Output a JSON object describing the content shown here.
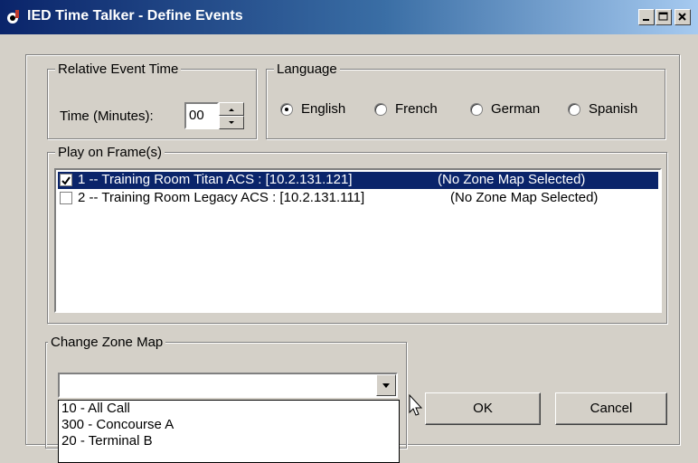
{
  "window": {
    "title": "IED Time Talker - Define Events",
    "icon": "app-icon",
    "controls": [
      "minimize-icon",
      "maximize-icon",
      "close-icon"
    ]
  },
  "relative_event_time": {
    "legend": "Relative Event Time",
    "label": "Time (Minutes):",
    "value": "00"
  },
  "language": {
    "legend": "Language",
    "options": [
      {
        "label": "English",
        "selected": true
      },
      {
        "label": "French",
        "selected": false
      },
      {
        "label": "German",
        "selected": false
      },
      {
        "label": "Spanish",
        "selected": false
      }
    ]
  },
  "play_on_frames": {
    "legend": "Play on Frame(s)",
    "items": [
      {
        "label": "1 -- Training Room Titan ACS : [10.2.131.121]",
        "zone": "(No Zone Map Selected)",
        "checked": true,
        "selected": true
      },
      {
        "label": "2 -- Training Room Legacy ACS : [10.2.131.111]",
        "zone": "(No Zone Map Selected)",
        "checked": false,
        "selected": false
      }
    ]
  },
  "change_zone_map": {
    "legend": "Change Zone Map",
    "value": "",
    "options": [
      "10 - All Call",
      "300 - Concourse A",
      "20 - Terminal B"
    ]
  },
  "buttons": {
    "ok": "OK",
    "cancel": "Cancel"
  },
  "colors": {
    "title_bar_start": "#0a246a",
    "title_bar_end": "#a6caf0",
    "selection": "#0a246a",
    "face": "#d4d0c8"
  }
}
